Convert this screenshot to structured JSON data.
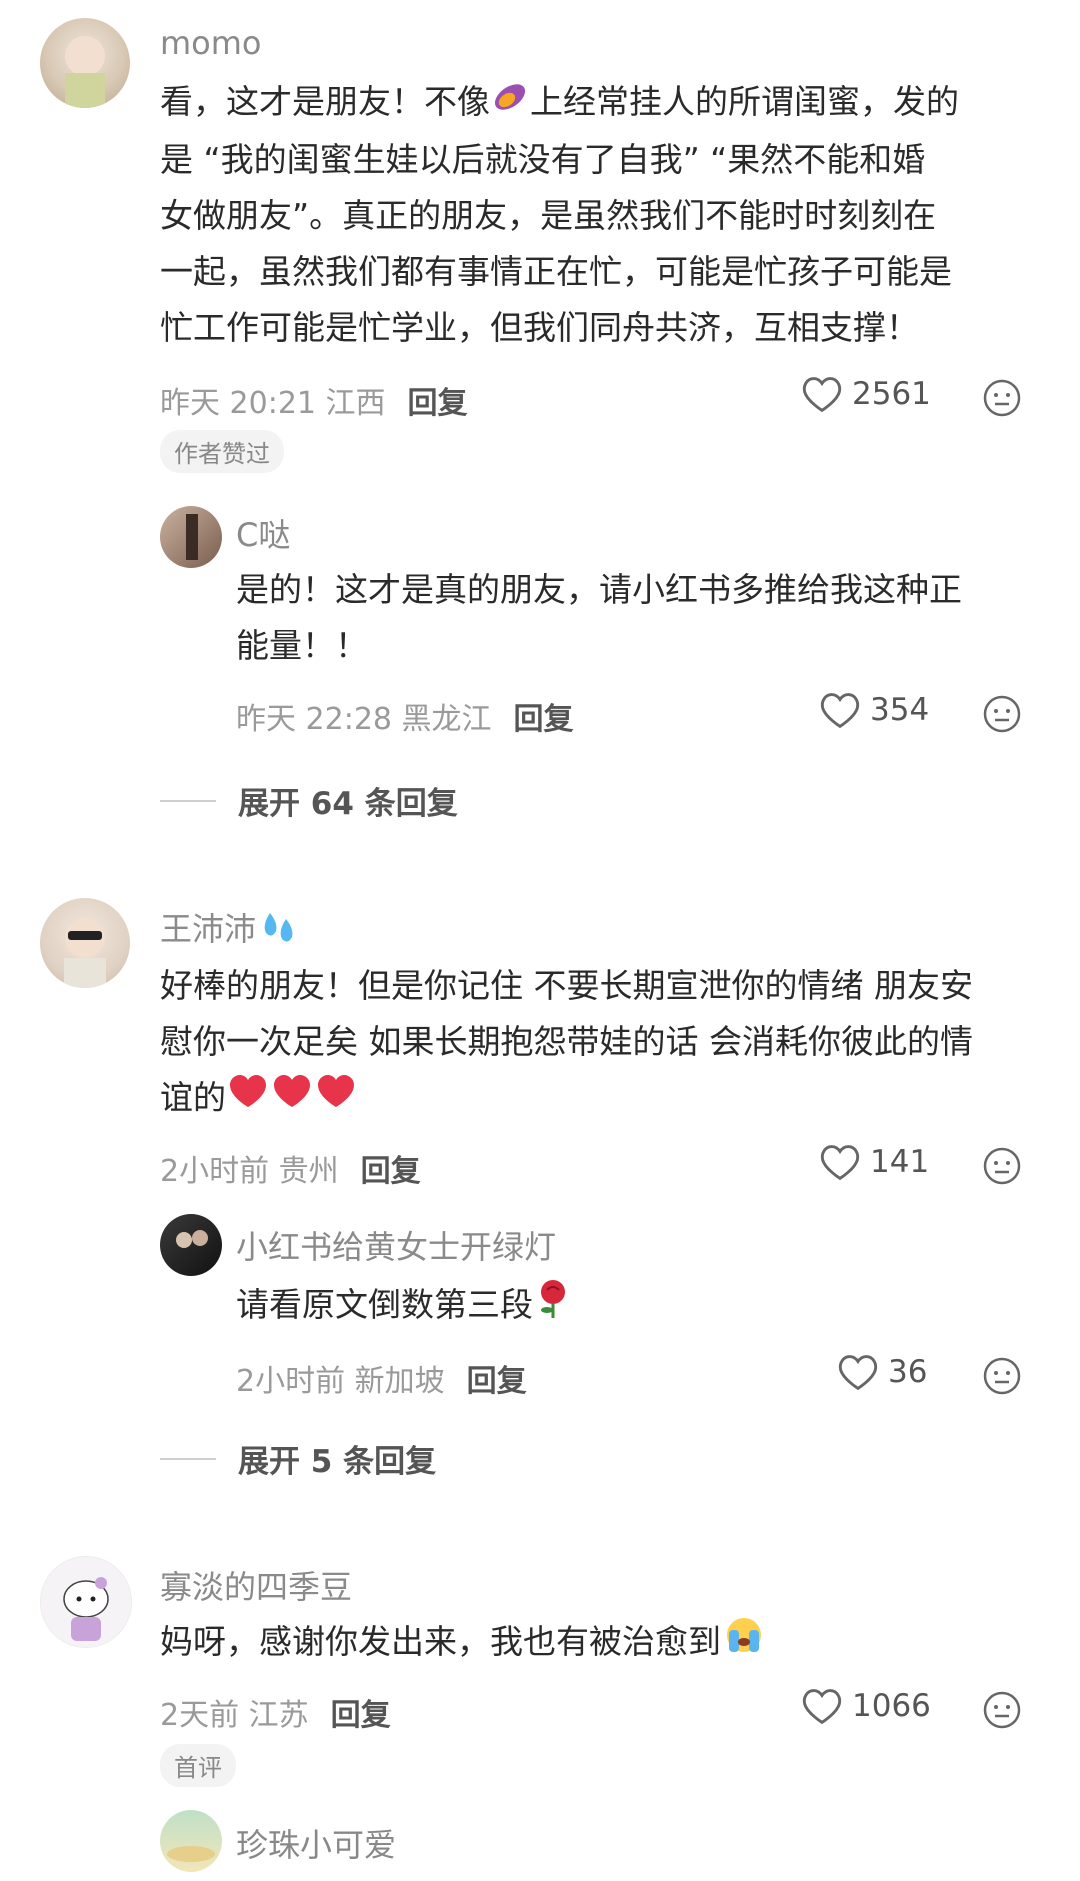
{
  "comments": [
    {
      "user": "momo",
      "text_lines": [
        "看，这才是朋友！不像",
        "上经常挂人的所谓闺蜜，发的",
        "是 “我的闺蜜生娃以后就没有了自我” “果然不能和婚",
        "女做朋友”。真正的朋友，是虽然我们不能时时刻刻在",
        "一起，虽然我们都有事情正在忙，可能是忙孩子可能是",
        "忙工作可能是忙学业，但我们同舟共济，互相支撑！"
      ],
      "time": "昨天 20:21 江西",
      "reply": "回复",
      "likes": "2561",
      "tag": "作者赞过",
      "sub_reply": {
        "user": "C哒",
        "text_lines": [
          "是的！这才是真的朋友，请小红书多推给我这种正",
          "能量！！"
        ],
        "time": "昨天 22:28 黑龙江",
        "reply": "回复",
        "likes": "354"
      },
      "expand": "展开 64 条回复"
    },
    {
      "user": "王沛沛",
      "text_lines": [
        "好棒的朋友！但是你记住 不要长期宣泄你的情绪 朋友安",
        "慰你一次足矣 如果长期抱怨带娃的话 会消耗你彼此的情",
        "谊的"
      ],
      "time": "2小时前 贵州",
      "reply": "回复",
      "likes": "141",
      "sub_reply": {
        "user": "小红书给黄女士开绿灯",
        "text_lines": [
          "请看原文倒数第三段"
        ],
        "time": "2小时前 新加坡",
        "reply": "回复",
        "likes": "36"
      },
      "expand": "展开 5 条回复"
    },
    {
      "user": "寡淡的四季豆",
      "text_lines": [
        "妈呀，感谢你发出来，我也有被治愈到"
      ],
      "time": "2天前 江苏",
      "reply": "回复",
      "likes": "1066",
      "tag": "首评"
    },
    {
      "user": "珍珠小可爱"
    }
  ],
  "colors": {
    "heart_emoji": "#e8344a",
    "text": "#2a2a2a",
    "meta": "#9a9a9a"
  },
  "icons": [
    "heart-outline-icon",
    "neutral-face-icon",
    "sweet-potato-icon",
    "sweat-drops-icon",
    "rose-icon",
    "crying-face-icon"
  ]
}
